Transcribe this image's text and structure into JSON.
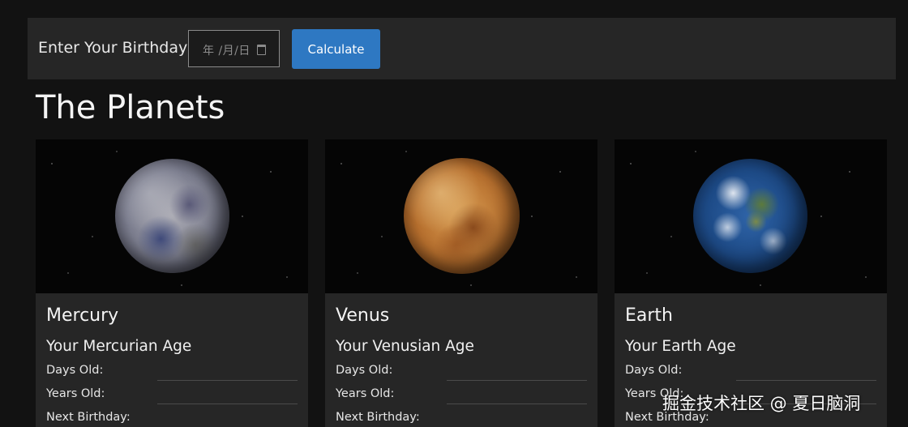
{
  "topbar": {
    "label": "Enter Your Birthday",
    "date_placeholder": "年 /月/日",
    "calculate_label": "Calculate"
  },
  "page_title": "The Planets",
  "cards": [
    {
      "name": "Mercury",
      "age_title": "Your Mercurian Age",
      "rows": [
        {
          "label": "Days Old:",
          "value": ""
        },
        {
          "label": "Years Old:",
          "value": ""
        },
        {
          "label": "Next Birthday:",
          "value": ""
        }
      ]
    },
    {
      "name": "Venus",
      "age_title": "Your Venusian Age",
      "rows": [
        {
          "label": "Days Old:",
          "value": ""
        },
        {
          "label": "Years Old:",
          "value": ""
        },
        {
          "label": "Next Birthday:",
          "value": ""
        }
      ]
    },
    {
      "name": "Earth",
      "age_title": "Your Earth Age",
      "rows": [
        {
          "label": "Days Old:",
          "value": ""
        },
        {
          "label": "Years Old:",
          "value": ""
        },
        {
          "label": "Next Birthday:",
          "value": ""
        }
      ]
    }
  ],
  "watermark": "掘金技术社区 @ 夏日脑洞",
  "colors": {
    "background": "#121212",
    "panel": "#262626",
    "button": "#2e78c2"
  },
  "icons": {
    "date_picker": "calendar-icon"
  }
}
